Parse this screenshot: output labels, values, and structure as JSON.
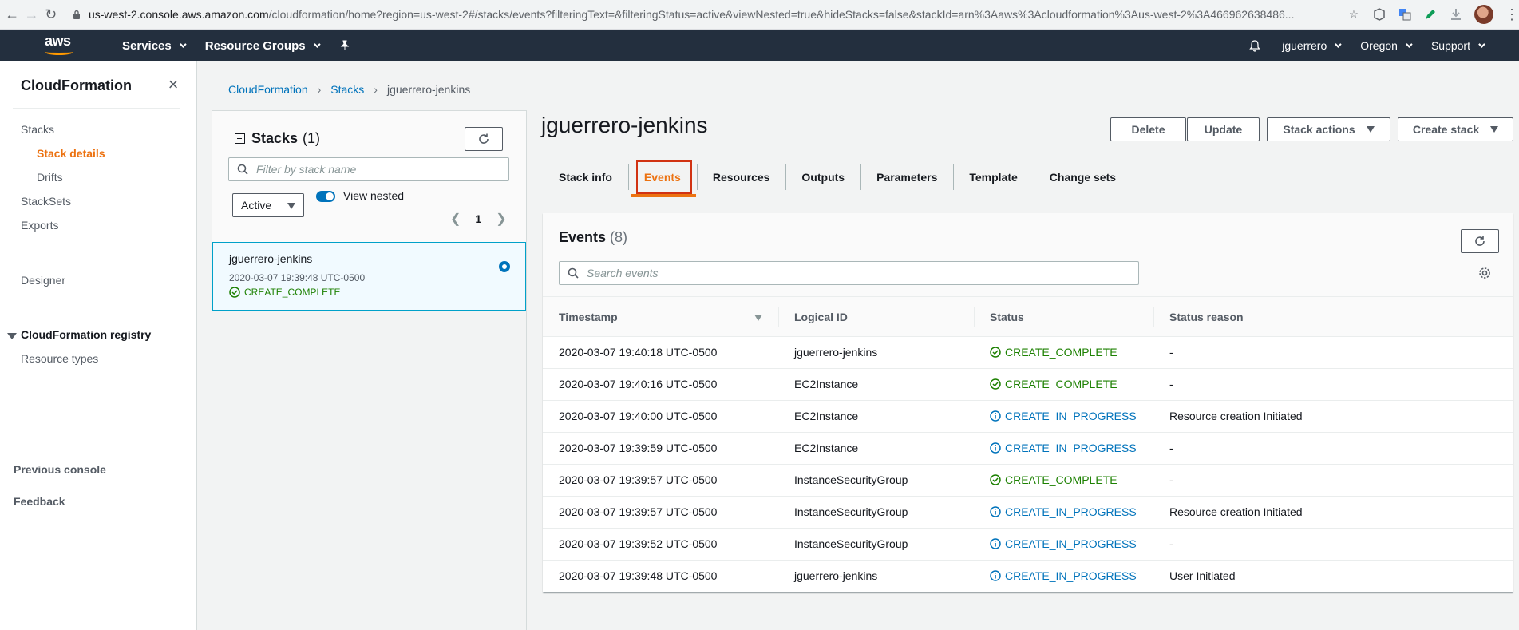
{
  "browser": {
    "url_host": "us-west-2.console.aws.amazon.com",
    "url_rest": "/cloudformation/home?region=us-west-2#/stacks/events?filteringText=&filteringStatus=active&viewNested=true&hideStacks=false&stackId=arn%3Aaws%3Acloudformation%3Aus-west-2%3A466962638486..."
  },
  "header": {
    "logo": "aws",
    "services": "Services",
    "resource_groups": "Resource Groups",
    "user": "jguerrero",
    "region": "Oregon",
    "support": "Support"
  },
  "leftnav": {
    "title": "CloudFormation",
    "stacks": "Stacks",
    "stack_details": "Stack details",
    "drifts": "Drifts",
    "stacksets": "StackSets",
    "exports": "Exports",
    "designer": "Designer",
    "registry": "CloudFormation registry",
    "resource_types": "Resource types",
    "previous_console": "Previous console",
    "feedback": "Feedback"
  },
  "breadcrumb": [
    "CloudFormation",
    "Stacks",
    "jguerrero-jenkins"
  ],
  "stacks_panel": {
    "title": "Stacks",
    "count": "(1)",
    "filter_placeholder": "Filter by stack name",
    "status_filter": "Active",
    "view_nested": "View nested",
    "page": "1",
    "stack": {
      "name": "jguerrero-jenkins",
      "timestamp": "2020-03-07 19:39:48 UTC-0500",
      "status": "CREATE_COMPLETE"
    }
  },
  "main": {
    "stack_title": "jguerrero-jenkins",
    "buttons": {
      "delete": "Delete",
      "update": "Update",
      "stack_actions": "Stack actions",
      "create_stack": "Create stack"
    },
    "tabs": [
      "Stack info",
      "Events",
      "Resources",
      "Outputs",
      "Parameters",
      "Template",
      "Change sets"
    ],
    "active_tab": "Events"
  },
  "events": {
    "title": "Events",
    "count": "(8)",
    "search_placeholder": "Search events",
    "columns": [
      "Timestamp",
      "Logical ID",
      "Status",
      "Status reason"
    ],
    "rows": [
      {
        "timestamp": "2020-03-07 19:40:18 UTC-0500",
        "logical_id": "jguerrero-jenkins",
        "status": "CREATE_COMPLETE",
        "kind": "ok",
        "reason": "-"
      },
      {
        "timestamp": "2020-03-07 19:40:16 UTC-0500",
        "logical_id": "EC2Instance",
        "status": "CREATE_COMPLETE",
        "kind": "ok",
        "reason": "-"
      },
      {
        "timestamp": "2020-03-07 19:40:00 UTC-0500",
        "logical_id": "EC2Instance",
        "status": "CREATE_IN_PROGRESS",
        "kind": "prog",
        "reason": "Resource creation Initiated"
      },
      {
        "timestamp": "2020-03-07 19:39:59 UTC-0500",
        "logical_id": "EC2Instance",
        "status": "CREATE_IN_PROGRESS",
        "kind": "prog",
        "reason": "-"
      },
      {
        "timestamp": "2020-03-07 19:39:57 UTC-0500",
        "logical_id": "InstanceSecurityGroup",
        "status": "CREATE_COMPLETE",
        "kind": "ok",
        "reason": "-"
      },
      {
        "timestamp": "2020-03-07 19:39:57 UTC-0500",
        "logical_id": "InstanceSecurityGroup",
        "status": "CREATE_IN_PROGRESS",
        "kind": "prog",
        "reason": "Resource creation Initiated"
      },
      {
        "timestamp": "2020-03-07 19:39:52 UTC-0500",
        "logical_id": "InstanceSecurityGroup",
        "status": "CREATE_IN_PROGRESS",
        "kind": "prog",
        "reason": "-"
      },
      {
        "timestamp": "2020-03-07 19:39:48 UTC-0500",
        "logical_id": "jguerrero-jenkins",
        "status": "CREATE_IN_PROGRESS",
        "kind": "prog",
        "reason": "User Initiated"
      }
    ]
  },
  "colors": {
    "accent": "#ec7211",
    "link": "#0073bb",
    "success": "#1d8102",
    "header_bg": "#232f3e",
    "highlight_box": "#d13212"
  }
}
